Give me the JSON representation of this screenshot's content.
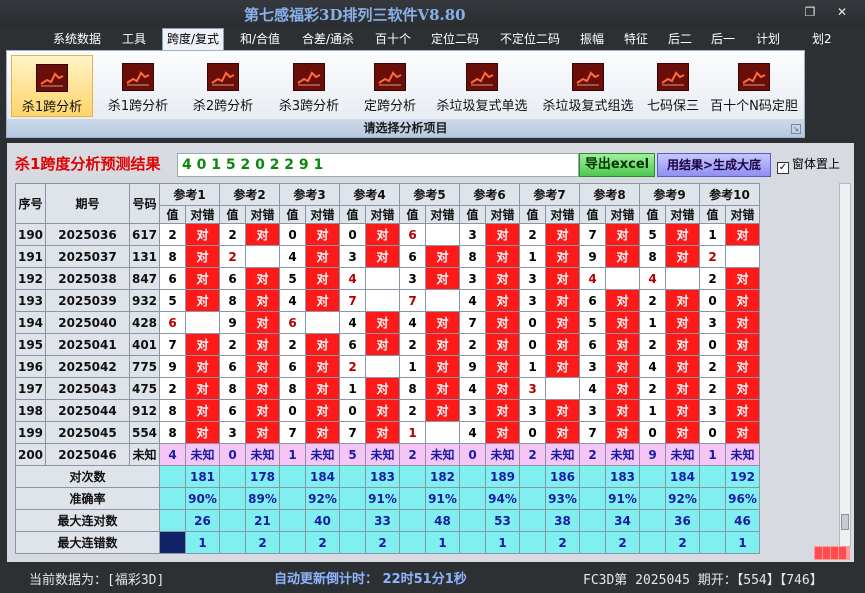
{
  "app": {
    "title": "第七感福彩3D排列三软件V8.80"
  },
  "window": {
    "restore": "❐",
    "close": "✕"
  },
  "menu": [
    "系统数据",
    "工具",
    "跨度/复式",
    "和/合值",
    "合差/通杀",
    "百十个",
    "定位二码",
    "不定位二码",
    "振幅",
    "特征",
    "后二",
    "后一",
    "计划",
    "划2"
  ],
  "active_menu": "跨度/复式",
  "ribbon": {
    "buttons": [
      "杀1跨分析",
      "杀1跨分析",
      "杀2跨分析",
      "杀3跨分析",
      "定跨分析",
      "杀垃圾复式单选",
      "杀垃圾复式组选",
      "七码保三",
      "百十个N码定胆"
    ],
    "caption": "请选择分析项目",
    "icon": "chart-icon"
  },
  "result": {
    "label": "杀1跨度分析预测结果",
    "value": "4 0 1 5 2 0 2 2 9 1",
    "export_button": "导出excel",
    "generate_button": "用结果>生成大底",
    "ontop_label": "窗体置上",
    "ontop_checked": "✓"
  },
  "table": {
    "headers": {
      "seq": "序号",
      "period": "期号",
      "number": "号码"
    },
    "refs": [
      "参考1",
      "参考2",
      "参考3",
      "参考4",
      "参考5",
      "参考6",
      "参考7",
      "参考8",
      "参考9",
      "参考10"
    ],
    "sub": [
      "值",
      "对错"
    ],
    "rows": [
      {
        "seq": "190",
        "period": "2025036",
        "number": "617",
        "vals": [
          "2",
          "2",
          "0",
          "0",
          "6",
          "3",
          "2",
          "7",
          "5",
          "1"
        ],
        "marks": [
          "对",
          "对",
          "对",
          "对",
          "",
          "对",
          "对",
          "对",
          "对",
          "对"
        ]
      },
      {
        "seq": "191",
        "period": "2025037",
        "number": "131",
        "vals": [
          "8",
          "2",
          "4",
          "3",
          "6",
          "8",
          "1",
          "9",
          "8",
          "2"
        ],
        "marks": [
          "对",
          "",
          "对",
          "对",
          "对",
          "对",
          "对",
          "对",
          "对",
          ""
        ]
      },
      {
        "seq": "192",
        "period": "2025038",
        "number": "847",
        "vals": [
          "6",
          "6",
          "5",
          "4",
          "3",
          "3",
          "3",
          "4",
          "4",
          "2"
        ],
        "marks": [
          "对",
          "对",
          "对",
          "",
          "对",
          "对",
          "对",
          "",
          "",
          "对"
        ]
      },
      {
        "seq": "193",
        "period": "2025039",
        "number": "932",
        "vals": [
          "5",
          "8",
          "4",
          "7",
          "7",
          "4",
          "3",
          "6",
          "2",
          "0"
        ],
        "marks": [
          "对",
          "对",
          "对",
          "",
          "",
          "对",
          "对",
          "对",
          "对",
          "对"
        ]
      },
      {
        "seq": "194",
        "period": "2025040",
        "number": "428",
        "vals": [
          "6",
          "9",
          "6",
          "4",
          "4",
          "7",
          "0",
          "5",
          "1",
          "3"
        ],
        "marks": [
          "",
          "对",
          "",
          "对",
          "对",
          "对",
          "对",
          "对",
          "对",
          "对"
        ]
      },
      {
        "seq": "195",
        "period": "2025041",
        "number": "401",
        "vals": [
          "7",
          "2",
          "2",
          "6",
          "2",
          "2",
          "0",
          "6",
          "2",
          "0"
        ],
        "marks": [
          "对",
          "对",
          "对",
          "对",
          "对",
          "对",
          "对",
          "对",
          "对",
          "对"
        ]
      },
      {
        "seq": "196",
        "period": "2025042",
        "number": "775",
        "vals": [
          "9",
          "6",
          "6",
          "2",
          "1",
          "9",
          "1",
          "3",
          "4",
          "2"
        ],
        "marks": [
          "对",
          "对",
          "对",
          "",
          "对",
          "对",
          "对",
          "对",
          "对",
          "对"
        ]
      },
      {
        "seq": "197",
        "period": "2025043",
        "number": "475",
        "vals": [
          "2",
          "8",
          "8",
          "1",
          "8",
          "4",
          "3",
          "4",
          "2",
          "2"
        ],
        "marks": [
          "对",
          "对",
          "对",
          "对",
          "对",
          "对",
          "",
          "对",
          "对",
          "对"
        ]
      },
      {
        "seq": "198",
        "period": "2025044",
        "number": "912",
        "vals": [
          "8",
          "6",
          "0",
          "0",
          "2",
          "3",
          "3",
          "3",
          "1",
          "3"
        ],
        "marks": [
          "对",
          "对",
          "对",
          "对",
          "对",
          "对",
          "对",
          "对",
          "对",
          "对"
        ]
      },
      {
        "seq": "199",
        "period": "2025045",
        "number": "554",
        "vals": [
          "8",
          "3",
          "7",
          "7",
          "1",
          "4",
          "0",
          "7",
          "0",
          "0"
        ],
        "marks": [
          "对",
          "对",
          "对",
          "对",
          "",
          "对",
          "对",
          "对",
          "对",
          "对"
        ]
      }
    ],
    "red_values": [
      "191-2",
      "191-10",
      "192-4",
      "192-8",
      "192-9",
      "193-4",
      "193-5",
      "194-1",
      "194-3",
      "196-4",
      "197-7",
      "199-5",
      "190-5"
    ],
    "pending": {
      "seq": "200",
      "period": "2025046",
      "number": "未知",
      "vals": [
        "4",
        "0",
        "1",
        "5",
        "2",
        "0",
        "2",
        "2",
        "9",
        "1"
      ],
      "label": "未知"
    },
    "summary": [
      {
        "label": "对次数",
        "vals": [
          "181",
          "178",
          "184",
          "183",
          "182",
          "189",
          "186",
          "183",
          "184",
          "192"
        ]
      },
      {
        "label": "准确率",
        "vals": [
          "90%",
          "89%",
          "92%",
          "91%",
          "91%",
          "94%",
          "93%",
          "91%",
          "92%",
          "96%"
        ]
      },
      {
        "label": "最大连对数",
        "vals": [
          "26",
          "21",
          "40",
          "33",
          "48",
          "53",
          "38",
          "34",
          "36",
          "46"
        ]
      },
      {
        "label": "最大连错数",
        "vals": [
          "1",
          "2",
          "2",
          "2",
          "1",
          "1",
          "2",
          "2",
          "2",
          "1"
        ]
      }
    ]
  },
  "status": {
    "left": "当前数据为：[福彩3D]",
    "middle": "自动更新倒计时：  22时51分1秒",
    "right": "FC3D第 2025045 期开：【554】【746】"
  },
  "colors": {
    "hit": "#ff1a1a",
    "summary": "#7ff0ef",
    "pending": "#f5c6f5",
    "title": "#8ab0ea"
  }
}
